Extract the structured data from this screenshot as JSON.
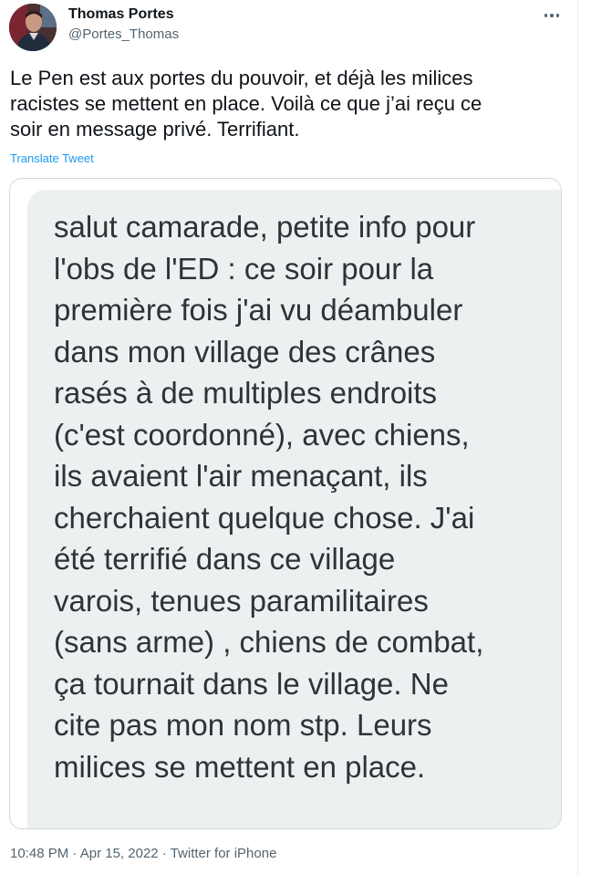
{
  "tweet": {
    "author": {
      "display_name": "Thomas Portes",
      "handle": "@Portes_Thomas",
      "avatar_icon": "profile-photo"
    },
    "more_icon": "more-horizontal-icon",
    "text": "Le Pen est aux portes du pouvoir, et déjà les milices\nracistes se mettent en place. Voilà ce que j’ai reçu ce\nsoir en message privé. Terrifiant.",
    "translate_label": "Translate Tweet",
    "media": {
      "message_text": "salut camarade, petite info pour\nl'obs de l'ED : ce soir pour la\npremière fois j'ai vu déambuler\ndans mon village des crânes\nrasés à de multiples endroits\n(c'est coordonné), avec chiens,\nils avaient l'air menaçant, ils\ncherchaient quelque chose. J'ai\nété terrifié dans ce village\nvarois, tenues paramilitaires\n(sans arme) , chiens de combat,\nça tournait dans le village. Ne\ncite pas mon nom stp. Leurs\nmilices se mettent en place."
    },
    "time": "10:48 PM",
    "separator": " · ",
    "date": "Apr 15, 2022",
    "source": "Twitter for iPhone"
  },
  "colors": {
    "text_primary": "#0f1419",
    "text_secondary": "#536471",
    "link": "#1d9bf0",
    "bubble_bg": "#ecf0f0",
    "bubble_text": "#303236",
    "border": "#cfd9de"
  }
}
